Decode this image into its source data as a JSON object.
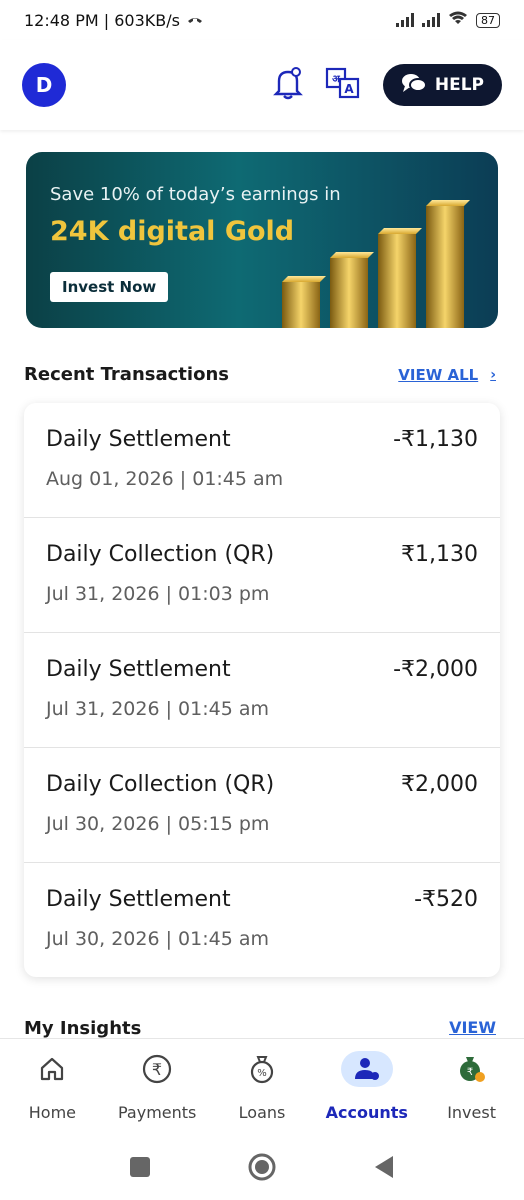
{
  "status_bar": {
    "time_speed": "12:48 PM | 603KB/s",
    "battery": "87"
  },
  "header": {
    "avatar_letter": "D",
    "help_label": "HELP"
  },
  "banner": {
    "line1": "Save 10% of today’s earnings in",
    "line2": "24K digital Gold",
    "cta": "Invest Now"
  },
  "recent": {
    "title": "Recent Transactions",
    "view_all": "VIEW ALL",
    "items": [
      {
        "name": "Daily Settlement",
        "date": "Aug 01, 2026 | 01:45 am",
        "amount": "-₹1,130"
      },
      {
        "name": "Daily Collection (QR)",
        "date": "Jul 31, 2026 | 01:03 pm",
        "amount": "₹1,130"
      },
      {
        "name": "Daily Settlement",
        "date": "Jul 31, 2026 | 01:45 am",
        "amount": "-₹2,000"
      },
      {
        "name": "Daily Collection (QR)",
        "date": "Jul 30, 2026 | 05:15 pm",
        "amount": "₹2,000"
      },
      {
        "name": "Daily Settlement",
        "date": "Jul 30, 2026 | 01:45 am",
        "amount": "-₹520"
      }
    ]
  },
  "insights": {
    "title": "My Insights",
    "view": "VIEW"
  },
  "nav": {
    "items": [
      {
        "label": "Home",
        "icon": "home-icon"
      },
      {
        "label": "Payments",
        "icon": "rupee-icon"
      },
      {
        "label": "Loans",
        "icon": "money-bag-icon"
      },
      {
        "label": "Accounts",
        "icon": "account-icon",
        "active": true
      },
      {
        "label": "Invest",
        "icon": "invest-icon"
      }
    ]
  },
  "colors": {
    "accent": "#1d28b9",
    "link": "#2a63d6",
    "help_bg": "#0e1730",
    "gold": "#f0c53d"
  }
}
